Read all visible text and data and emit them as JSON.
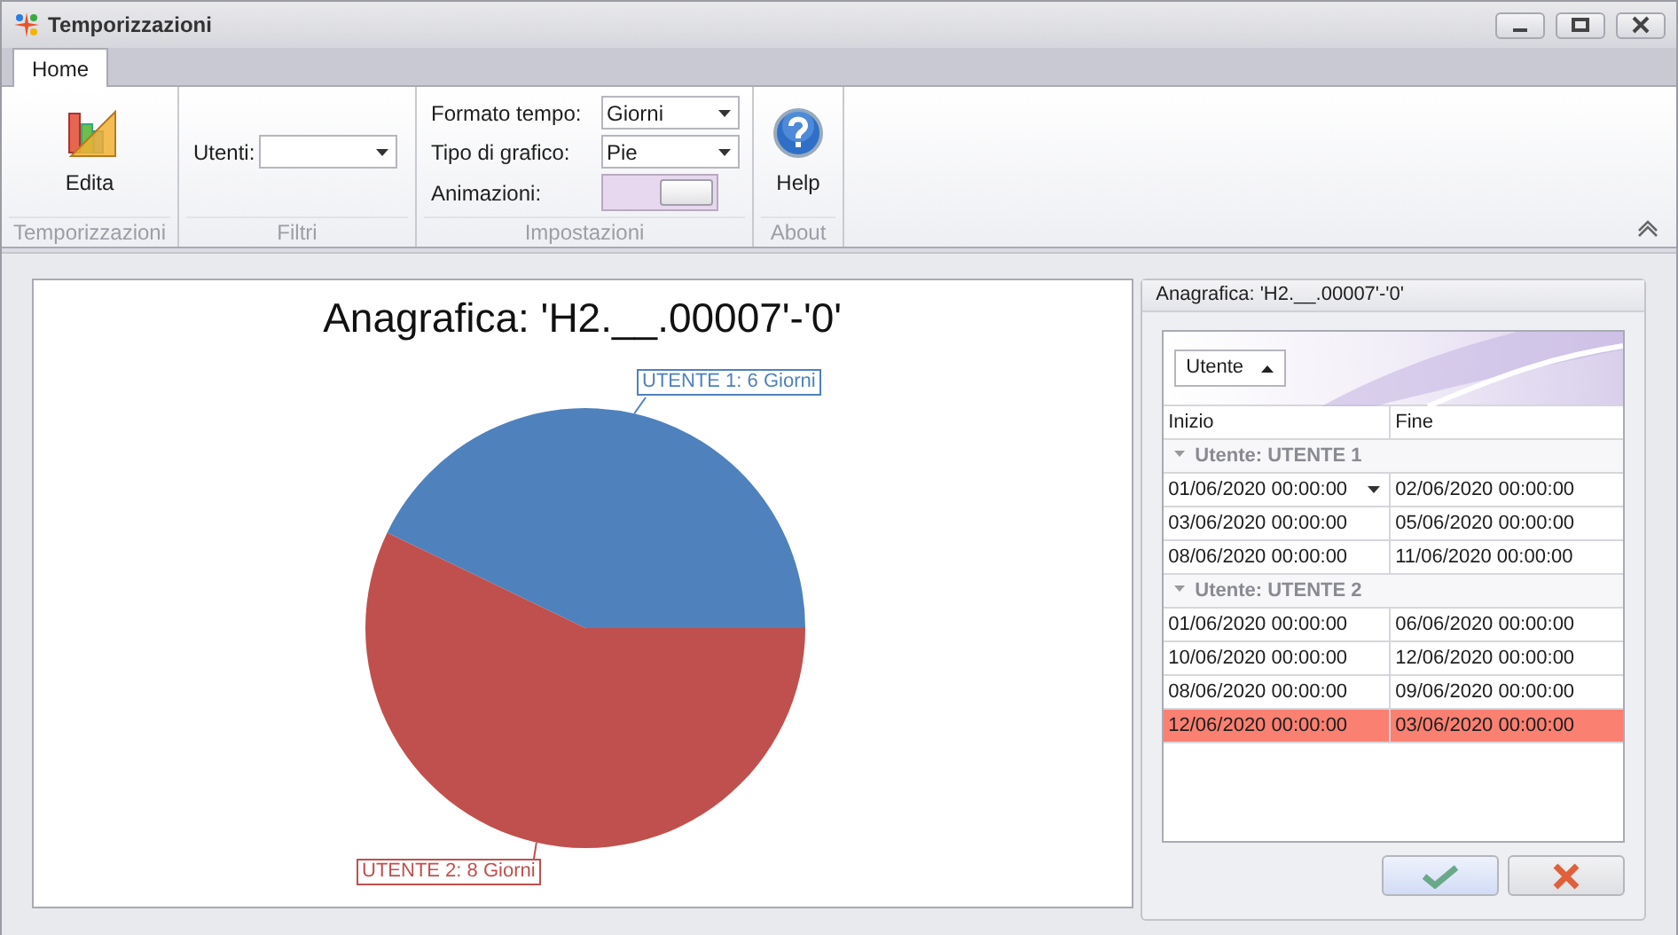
{
  "window": {
    "title": "Temporizzazioni"
  },
  "tabs": [
    {
      "label": "Home",
      "selected": true
    }
  ],
  "ribbon": {
    "groups": [
      {
        "kind": "edit",
        "label": "Temporizzazioni",
        "button": "Edita"
      },
      {
        "kind": "filter",
        "label": "Filtri",
        "field_label": "Utenti:"
      },
      {
        "kind": "settings",
        "label": "Impostazioni",
        "format_label": "Formato tempo:",
        "format_value": "Giorni",
        "chart_label": "Tipo di grafico:",
        "chart_value": "Pie",
        "animations_label": "Animazioni:",
        "animations_on": true
      },
      {
        "kind": "help",
        "label": "About",
        "button": "Help"
      }
    ]
  },
  "chart": {
    "chart_data": {
      "type": "pie",
      "title": "Anagrafica: 'H2.__.00007'-'0'",
      "categories": [
        "UTENTE 1: 6 Giorni",
        "UTENTE 2: 8 Giorni"
      ],
      "series": [
        {
          "values": [
            6,
            8
          ],
          "colors": [
            "#4f81bd",
            "#c0504d"
          ]
        }
      ]
    }
  },
  "grid_panel": {
    "title": "Anagrafica: 'H2.__.00007'-'0'",
    "group_by": "Utente",
    "columns": [
      "Inizio",
      "Fine"
    ],
    "rows": [
      {
        "kind": "group",
        "label": "Utente: UTENTE 1",
        "expanded": true
      },
      {
        "kind": "row",
        "cells": [
          "01/06/2020 00:00:00",
          "02/06/2020 00:00:00"
        ],
        "editing": true,
        "selected": false
      },
      {
        "kind": "row",
        "cells": [
          "03/06/2020 00:00:00",
          "05/06/2020 00:00:00"
        ],
        "editing": false,
        "selected": false
      },
      {
        "kind": "row",
        "cells": [
          "08/06/2020 00:00:00",
          "11/06/2020 00:00:00"
        ],
        "editing": false,
        "selected": false
      },
      {
        "kind": "group",
        "label": "Utente: UTENTE 2",
        "expanded": true
      },
      {
        "kind": "row",
        "cells": [
          "01/06/2020 00:00:00",
          "06/06/2020 00:00:00"
        ],
        "editing": false,
        "selected": false
      },
      {
        "kind": "row",
        "cells": [
          "10/06/2020 00:00:00",
          "12/06/2020 00:00:00"
        ],
        "editing": false,
        "selected": false
      },
      {
        "kind": "row",
        "cells": [
          "08/06/2020 00:00:00",
          "09/06/2020 00:00:00"
        ],
        "editing": false,
        "selected": false
      },
      {
        "kind": "row",
        "cells": [
          "12/06/2020 00:00:00",
          "03/06/2020 00:00:00"
        ],
        "editing": false,
        "selected": true
      }
    ]
  }
}
